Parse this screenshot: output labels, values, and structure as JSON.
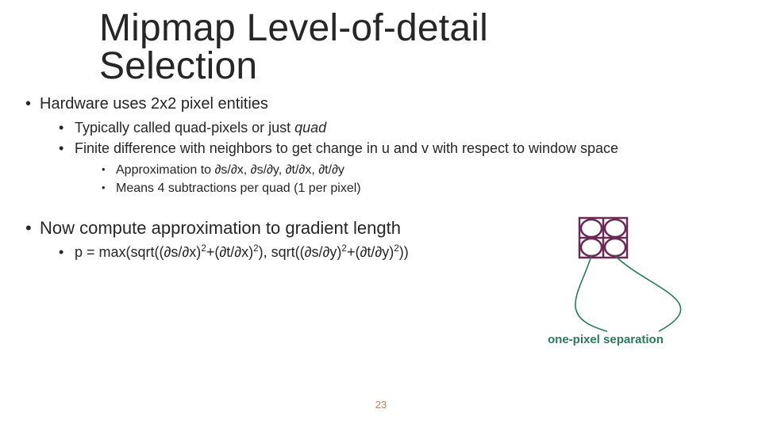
{
  "title_line1": "Mipmap Level-of-detail",
  "title_line2": "Selection",
  "bullets": {
    "b1": "Hardware uses 2x2 pixel entities",
    "b1a_pre": "Typically called quad-pixels or just ",
    "b1a_em": "quad",
    "b1b": "Finite difference with neighbors to get change in u and v with respect to window space",
    "b1b_i": "Approximation to ∂s/∂x, ∂s/∂y, ∂t/∂x, ∂t/∂y",
    "b1b_ii": "Means 4 subtractions per quad (1 per pixel)",
    "b2": "Now compute approximation to gradient length",
    "b2a": "p = max(sqrt((∂s/∂x)2+(∂t/∂x)2), sqrt((∂s/∂y)2+(∂t/∂y)2))"
  },
  "annotation": "one-pixel separation",
  "page_number": "23",
  "colors": {
    "quad_stroke": "#6a2a55",
    "curve_stroke": "#2a7a5a"
  }
}
